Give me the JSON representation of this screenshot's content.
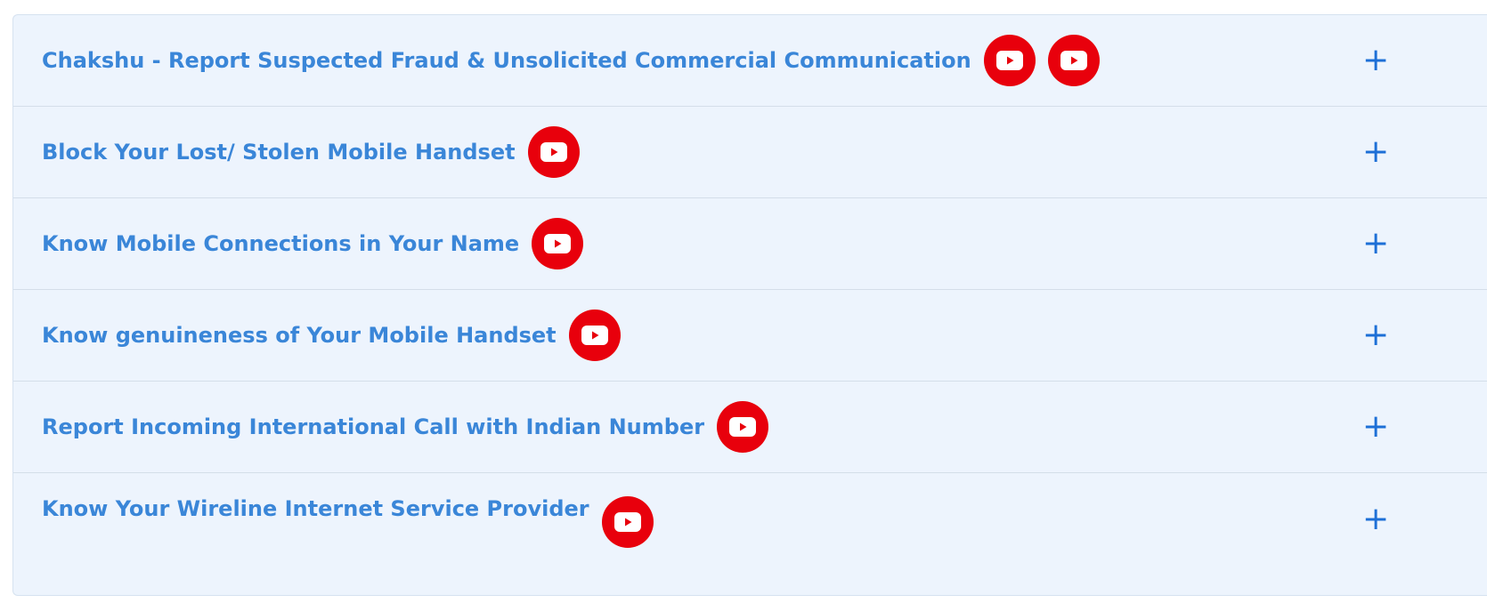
{
  "accordion": {
    "items": [
      {
        "title": "Chakshu - Report Suspected Fraud & Unsolicited Commercial Communication",
        "video_icons": 2
      },
      {
        "title": "Block Your Lost/ Stolen Mobile Handset",
        "video_icons": 1
      },
      {
        "title": "Know Mobile Connections in Your Name",
        "video_icons": 1
      },
      {
        "title": "Know genuineness of Your Mobile Handset",
        "video_icons": 1
      },
      {
        "title": "Report Incoming International Call with Indian Number",
        "video_icons": 1
      },
      {
        "title": "Know Your Wireline Internet Service Provider",
        "video_icons": 1
      }
    ],
    "expand_symbol": "+"
  },
  "colors": {
    "title": "#3a86d8",
    "background": "#edf4fd",
    "youtube_red": "#e8000c",
    "plus": "#1d6fd6"
  },
  "icons": {
    "video": "youtube-icon",
    "expand": "plus-icon"
  }
}
